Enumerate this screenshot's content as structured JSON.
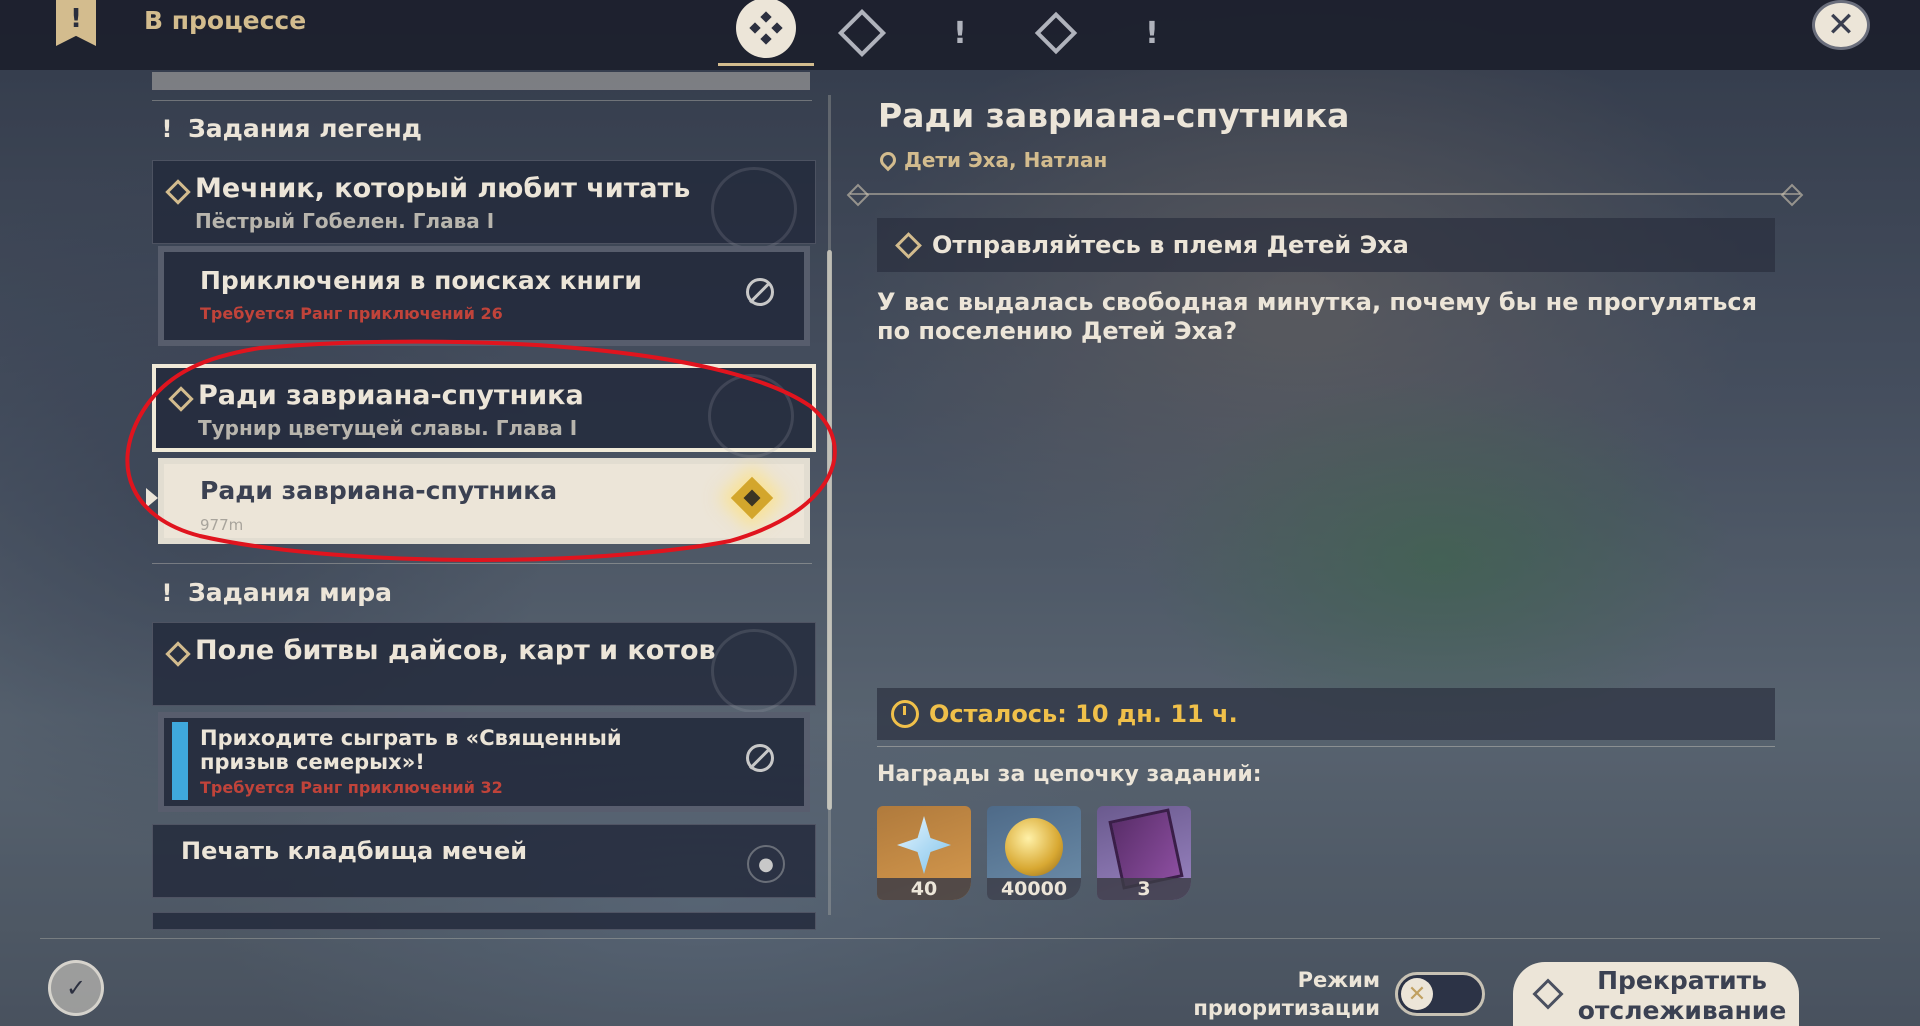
{
  "topbar": {
    "title": "В процессе",
    "bookmark_glyph": "!",
    "close_glyph": "✕",
    "tabs": [
      {
        "icon": "all-quests-icon",
        "active": true
      },
      {
        "icon": "archon-quests-icon",
        "active": false
      },
      {
        "icon": "legend-quests-icon",
        "active": false
      },
      {
        "icon": "commission-icon",
        "active": false
      },
      {
        "icon": "world-quests-icon",
        "active": false
      }
    ]
  },
  "quest_list": {
    "sections": [
      {
        "label": "Задания легенд",
        "groups": [
          {
            "title": "Мечник, который любит читать",
            "subtitle": "Пёстрый Гобелен. Глава I",
            "steps": [
              {
                "title": "Приключения в поисках книги",
                "requirement": "Требуется Ранг приключений 26",
                "locked": true
              }
            ]
          },
          {
            "title": "Ради завриана-спутника",
            "subtitle": "Турнир цветущей славы. Глава I",
            "selected": true,
            "steps": [
              {
                "title": "Ради завриана-спутника",
                "distance": "977m",
                "tracked": true
              }
            ]
          }
        ]
      },
      {
        "label": "Задания мира",
        "groups": [
          {
            "title": "Поле битвы дайсов, карт и котов",
            "subtitle": "",
            "steps": [
              {
                "title": "Приходите сыграть в «Священный призыв семерых»!",
                "requirement": "Требуется Ранг приключений 32",
                "locked": true
              }
            ]
          },
          {
            "title": "Печать кладбища мечей"
          }
        ]
      }
    ]
  },
  "detail": {
    "title": "Ради завриана-спутника",
    "location": "Дети Эха, Натлан",
    "objective": "Отправляйтесь в племя Детей Эха",
    "description": "У вас выдалась свободная минутка, почему бы не прогуляться по поселению Детей Эха?",
    "time_left": "Осталось: 10 дн. 11 ч.",
    "rewards_header": "Награды за цепочку заданий:",
    "rewards": [
      {
        "icon": "primogem-icon",
        "count": "40"
      },
      {
        "icon": "mora-icon",
        "count": "40000"
      },
      {
        "icon": "heros-wit-icon",
        "count": "3"
      }
    ]
  },
  "bottom": {
    "priority_label": "Режим приоритизации",
    "priority_on": false,
    "toggle_glyph": "✕",
    "stop_tracking_label": "Прекратить отслеживание"
  },
  "colors": {
    "gold": "#d3bc8e",
    "cream": "#ece5d8",
    "timer": "#f0c04a",
    "requirement": "#c0433a",
    "annotation": "#e0141e"
  }
}
